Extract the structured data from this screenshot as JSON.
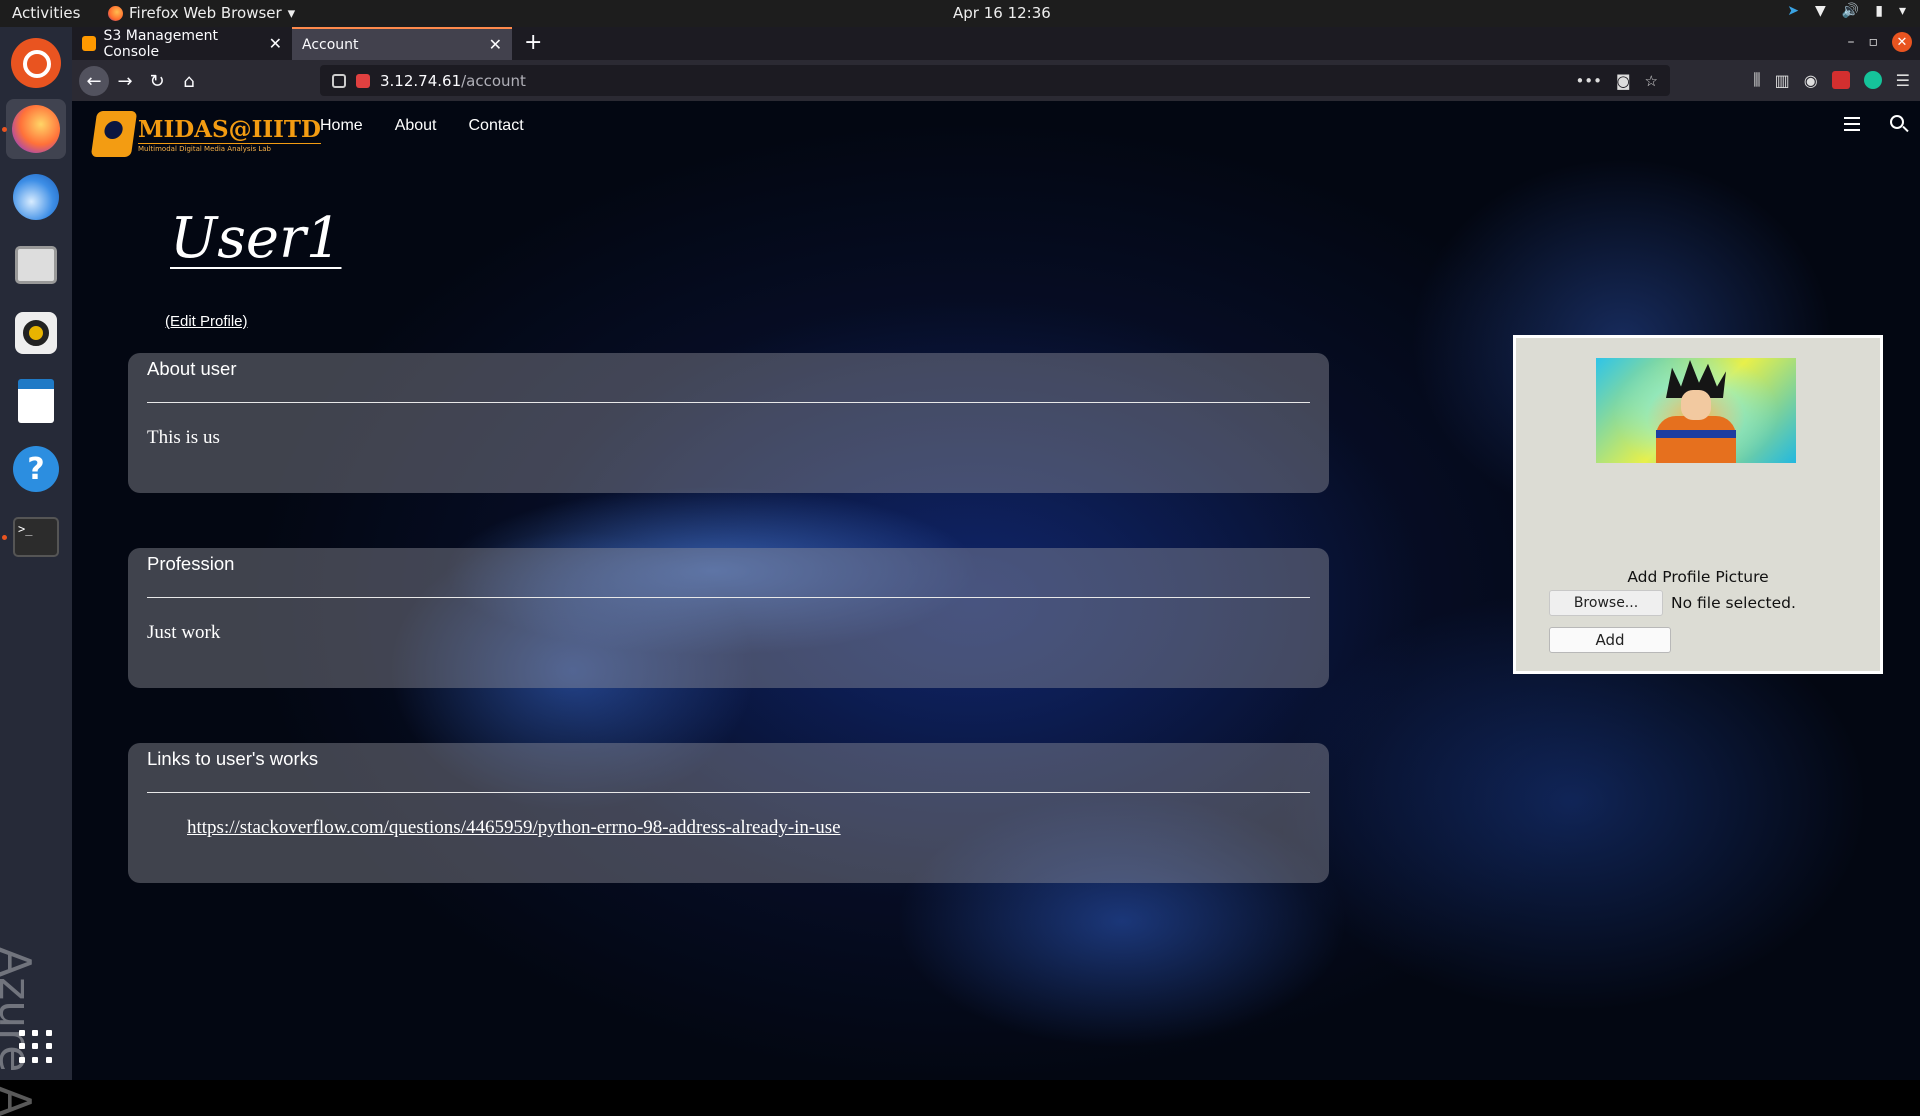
{
  "system": {
    "activities": "Activities",
    "app_menu": "Firefox Web Browser",
    "clock": "Apr 16  12:36"
  },
  "dock": {
    "side_text": "Azure A"
  },
  "browser": {
    "tabs": [
      {
        "label": "S3 Management Console",
        "active": false
      },
      {
        "label": "Account",
        "active": true
      }
    ],
    "url_host": "3.12.74.61",
    "url_path": "/account"
  },
  "site": {
    "logo_title": "MIDAS@IIITD",
    "logo_subtitle": "Multimodal Digital Media Analysis Lab",
    "nav": [
      "Home",
      "About",
      "Contact"
    ]
  },
  "profile": {
    "username": "User1",
    "edit_link": "(Edit Profile)",
    "about_title": "About user",
    "about_text": "This is us",
    "profession_title": "Profession",
    "profession_text": "Just work",
    "links_title": "Links to user's works",
    "link_url": "https://stackoverflow.com/questions/4465959/python-errno-98-address-already-in-use"
  },
  "picture_panel": {
    "label": "Add Profile Picture",
    "browse_label": "Browse...",
    "file_status": "No file selected.",
    "add_label": "Add"
  },
  "colors": {
    "accent": "#f39c12",
    "ubuntu_orange": "#e95420",
    "tab_highlight": "#ff8a4c"
  }
}
